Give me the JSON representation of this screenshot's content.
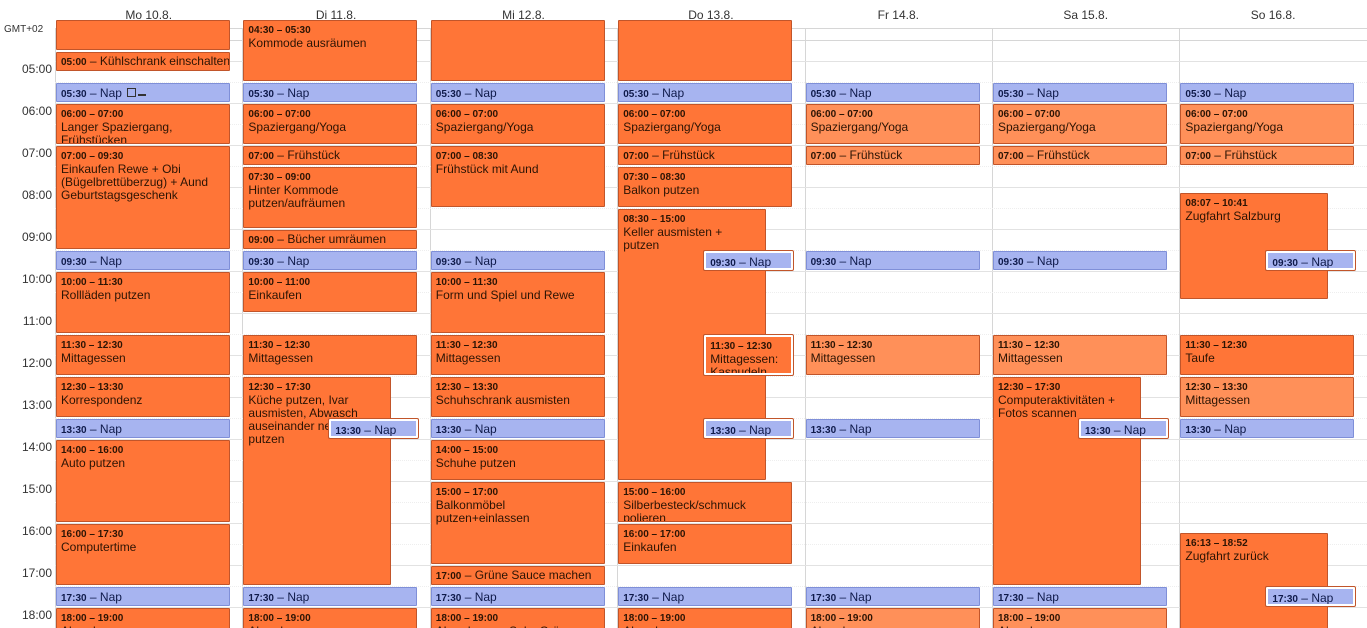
{
  "timezone": "GMT+02",
  "days": [
    "Mo 10.8.",
    "Di 11.8.",
    "Mi 12.8.",
    "Do 13.8.",
    "Fr 14.8.",
    "Sa 15.8.",
    "So 16.8."
  ],
  "hours": [
    "05:00",
    "06:00",
    "07:00",
    "08:00",
    "09:00",
    "10:00",
    "11:00",
    "12:00",
    "13:00",
    "14:00",
    "15:00",
    "16:00",
    "17:00",
    "18:00"
  ],
  "events": [
    {
      "day": 0,
      "start": "04:00",
      "end": "04:45",
      "time": "",
      "title": "",
      "color": "orange"
    },
    {
      "day": 0,
      "start": "04:45",
      "end": "05:15",
      "time": "05:00",
      "title": "Kühlschrank einschalten",
      "color": "orange",
      "oneline": true
    },
    {
      "day": 0,
      "start": "05:30",
      "end": "06:00",
      "time": "05:30",
      "title": "Nap",
      "color": "blue",
      "oneline": true,
      "icons": true
    },
    {
      "day": 0,
      "start": "06:00",
      "end": "07:00",
      "time": "06:00 – 07:00",
      "title": "Langer Spaziergang, Frühstücken",
      "color": "orange"
    },
    {
      "day": 0,
      "start": "07:00",
      "end": "09:30",
      "time": "07:00 – 09:30",
      "title": "Einkaufen Rewe + Obi (Bügelbrettüberzug) + Aund Geburtstagsgeschenk",
      "color": "orange"
    },
    {
      "day": 0,
      "start": "09:30",
      "end": "10:00",
      "time": "09:30",
      "title": "Nap",
      "color": "blue",
      "oneline": true
    },
    {
      "day": 0,
      "start": "10:00",
      "end": "11:30",
      "time": "10:00 – 11:30",
      "title": "Rollläden putzen",
      "color": "orange"
    },
    {
      "day": 0,
      "start": "11:30",
      "end": "12:30",
      "time": "11:30 – 12:30",
      "title": "Mittagessen",
      "color": "orange"
    },
    {
      "day": 0,
      "start": "12:30",
      "end": "13:30",
      "time": "12:30 – 13:30",
      "title": "Korrespondenz",
      "color": "orange"
    },
    {
      "day": 0,
      "start": "13:30",
      "end": "14:00",
      "time": "13:30",
      "title": "Nap",
      "color": "blue",
      "oneline": true
    },
    {
      "day": 0,
      "start": "14:00",
      "end": "16:00",
      "time": "14:00 – 16:00",
      "title": "Auto putzen",
      "color": "orange"
    },
    {
      "day": 0,
      "start": "16:00",
      "end": "17:30",
      "time": "16:00 – 17:30",
      "title": "Computertime",
      "color": "orange"
    },
    {
      "day": 0,
      "start": "17:30",
      "end": "18:00",
      "time": "17:30",
      "title": "Nap",
      "color": "blue",
      "oneline": true
    },
    {
      "day": 0,
      "start": "18:00",
      "end": "19:00",
      "time": "18:00 – 19:00",
      "title": "Abendessen",
      "color": "orange"
    },
    {
      "day": 1,
      "start": "04:00",
      "end": "05:30",
      "time": "04:30 – 05:30",
      "title": "Kommode ausräumen",
      "color": "orange"
    },
    {
      "day": 1,
      "start": "05:30",
      "end": "06:00",
      "time": "05:30",
      "title": "Nap",
      "color": "blue",
      "oneline": true
    },
    {
      "day": 1,
      "start": "06:00",
      "end": "07:00",
      "time": "06:00 – 07:00",
      "title": "Spaziergang/Yoga",
      "color": "orange"
    },
    {
      "day": 1,
      "start": "07:00",
      "end": "07:30",
      "time": "07:00",
      "title": "Frühstück",
      "color": "orange",
      "oneline": true
    },
    {
      "day": 1,
      "start": "07:30",
      "end": "09:00",
      "time": "07:30 – 09:00",
      "title": "Hinter Kommode putzen/aufräumen",
      "color": "orange"
    },
    {
      "day": 1,
      "start": "09:00",
      "end": "09:30",
      "time": "09:00",
      "title": "Bücher umräumen",
      "color": "orange",
      "oneline": true
    },
    {
      "day": 1,
      "start": "09:30",
      "end": "10:00",
      "time": "09:30",
      "title": "Nap",
      "color": "blue",
      "oneline": true
    },
    {
      "day": 1,
      "start": "10:00",
      "end": "11:00",
      "time": "10:00 – 11:00",
      "title": "Einkaufen",
      "color": "orange"
    },
    {
      "day": 1,
      "start": "11:30",
      "end": "12:30",
      "time": "11:30 – 12:30",
      "title": "Mittagessen",
      "color": "orange"
    },
    {
      "day": 1,
      "start": "12:30",
      "end": "17:30",
      "time": "12:30 – 17:30",
      "title": "Küche putzen, Ivar ausmisten, Abwasch auseinander nehmen, putzen",
      "color": "orange",
      "narrow": true
    },
    {
      "day": 1,
      "start": "13:30",
      "end": "14:00",
      "time": "13:30",
      "title": "Nap",
      "color": "blue",
      "oneline": true,
      "overlay": true
    },
    {
      "day": 1,
      "start": "17:30",
      "end": "18:00",
      "time": "17:30",
      "title": "Nap",
      "color": "blue",
      "oneline": true
    },
    {
      "day": 1,
      "start": "18:00",
      "end": "19:00",
      "time": "18:00 – 19:00",
      "title": "Abendessen",
      "color": "orange"
    },
    {
      "day": 2,
      "start": "04:00",
      "end": "05:30",
      "time": "",
      "title": "",
      "color": "orange"
    },
    {
      "day": 2,
      "start": "05:30",
      "end": "06:00",
      "time": "05:30",
      "title": "Nap",
      "color": "blue",
      "oneline": true
    },
    {
      "day": 2,
      "start": "06:00",
      "end": "07:00",
      "time": "06:00 – 07:00",
      "title": "Spaziergang/Yoga",
      "color": "orange"
    },
    {
      "day": 2,
      "start": "07:00",
      "end": "08:30",
      "time": "07:00 – 08:30",
      "title": "Frühstück mit Aund",
      "color": "orange"
    },
    {
      "day": 2,
      "start": "09:30",
      "end": "10:00",
      "time": "09:30",
      "title": "Nap",
      "color": "blue",
      "oneline": true
    },
    {
      "day": 2,
      "start": "10:00",
      "end": "11:30",
      "time": "10:00 – 11:30",
      "title": "Form und Spiel und Rewe",
      "color": "orange"
    },
    {
      "day": 2,
      "start": "11:30",
      "end": "12:30",
      "time": "11:30 – 12:30",
      "title": "Mittagessen",
      "color": "orange"
    },
    {
      "day": 2,
      "start": "12:30",
      "end": "13:30",
      "time": "12:30 – 13:30",
      "title": "Schuhschrank ausmisten",
      "color": "orange"
    },
    {
      "day": 2,
      "start": "13:30",
      "end": "14:00",
      "time": "13:30",
      "title": "Nap",
      "color": "blue",
      "oneline": true
    },
    {
      "day": 2,
      "start": "14:00",
      "end": "15:00",
      "time": "14:00 – 15:00",
      "title": "Schuhe putzen",
      "color": "orange"
    },
    {
      "day": 2,
      "start": "15:00",
      "end": "17:00",
      "time": "15:00 – 17:00",
      "title": "Balkonmöbel putzen+einlassen",
      "color": "orange"
    },
    {
      "day": 2,
      "start": "17:00",
      "end": "17:30",
      "time": "17:00",
      "title": "Grüne Sauce machen",
      "color": "orange",
      "oneline": true
    },
    {
      "day": 2,
      "start": "17:30",
      "end": "18:00",
      "time": "17:30",
      "title": "Nap",
      "color": "blue",
      "oneline": true
    },
    {
      "day": 2,
      "start": "18:00",
      "end": "19:00",
      "time": "18:00 – 19:00",
      "title": "Abendessen: Sulz+Grüne",
      "color": "orange"
    },
    {
      "day": 3,
      "start": "04:00",
      "end": "05:30",
      "time": "",
      "title": "",
      "color": "orange"
    },
    {
      "day": 3,
      "start": "05:30",
      "end": "06:00",
      "time": "05:30",
      "title": "Nap",
      "color": "blue",
      "oneline": true
    },
    {
      "day": 3,
      "start": "06:00",
      "end": "07:00",
      "time": "06:00 – 07:00",
      "title": "Spaziergang/Yoga",
      "color": "orange"
    },
    {
      "day": 3,
      "start": "07:00",
      "end": "07:30",
      "time": "07:00",
      "title": "Frühstück",
      "color": "orange",
      "oneline": true
    },
    {
      "day": 3,
      "start": "07:30",
      "end": "08:30",
      "time": "07:30 – 08:30",
      "title": "Balkon putzen",
      "color": "orange"
    },
    {
      "day": 3,
      "start": "08:30",
      "end": "15:00",
      "time": "08:30 – 15:00",
      "title": "Keller ausmisten + putzen",
      "color": "orange",
      "narrow": true
    },
    {
      "day": 3,
      "start": "09:30",
      "end": "10:00",
      "time": "09:30",
      "title": "Nap",
      "color": "blue",
      "oneline": true,
      "overlay": true
    },
    {
      "day": 3,
      "start": "11:30",
      "end": "12:30",
      "time": "11:30 – 12:30",
      "title": "Mittagessen: Kasnudeln",
      "color": "orange",
      "overlay": true
    },
    {
      "day": 3,
      "start": "13:30",
      "end": "14:00",
      "time": "13:30",
      "title": "Nap",
      "color": "blue",
      "oneline": true,
      "overlay": true
    },
    {
      "day": 3,
      "start": "15:00",
      "end": "16:00",
      "time": "15:00 – 16:00",
      "title": "Silberbesteck/schmuck polieren",
      "color": "orange"
    },
    {
      "day": 3,
      "start": "16:00",
      "end": "17:00",
      "time": "16:00 – 17:00",
      "title": "Einkaufen",
      "color": "orange"
    },
    {
      "day": 3,
      "start": "17:30",
      "end": "18:00",
      "time": "17:30",
      "title": "Nap",
      "color": "blue",
      "oneline": true
    },
    {
      "day": 3,
      "start": "18:00",
      "end": "19:00",
      "time": "18:00 – 19:00",
      "title": "Abendessen",
      "color": "orange"
    },
    {
      "day": 4,
      "start": "05:30",
      "end": "06:00",
      "time": "05:30",
      "title": "Nap",
      "color": "blue",
      "oneline": true
    },
    {
      "day": 4,
      "start": "06:00",
      "end": "07:00",
      "time": "06:00 – 07:00",
      "title": "Spaziergang/Yoga",
      "color": "light"
    },
    {
      "day": 4,
      "start": "07:00",
      "end": "07:30",
      "time": "07:00",
      "title": "Frühstück",
      "color": "light",
      "oneline": true
    },
    {
      "day": 4,
      "start": "09:30",
      "end": "10:00",
      "time": "09:30",
      "title": "Nap",
      "color": "blue",
      "oneline": true
    },
    {
      "day": 4,
      "start": "11:30",
      "end": "12:30",
      "time": "11:30 – 12:30",
      "title": "Mittagessen",
      "color": "light"
    },
    {
      "day": 4,
      "start": "13:30",
      "end": "14:00",
      "time": "13:30",
      "title": "Nap",
      "color": "blue",
      "oneline": true
    },
    {
      "day": 4,
      "start": "17:30",
      "end": "18:00",
      "time": "17:30",
      "title": "Nap",
      "color": "blue",
      "oneline": true
    },
    {
      "day": 4,
      "start": "18:00",
      "end": "19:00",
      "time": "18:00 – 19:00",
      "title": "Abendessen",
      "color": "light"
    },
    {
      "day": 5,
      "start": "05:30",
      "end": "06:00",
      "time": "05:30",
      "title": "Nap",
      "color": "blue",
      "oneline": true
    },
    {
      "day": 5,
      "start": "06:00",
      "end": "07:00",
      "time": "06:00 – 07:00",
      "title": "Spaziergang/Yoga",
      "color": "light"
    },
    {
      "day": 5,
      "start": "07:00",
      "end": "07:30",
      "time": "07:00",
      "title": "Frühstück",
      "color": "light",
      "oneline": true
    },
    {
      "day": 5,
      "start": "09:30",
      "end": "10:00",
      "time": "09:30",
      "title": "Nap",
      "color": "blue",
      "oneline": true
    },
    {
      "day": 5,
      "start": "11:30",
      "end": "12:30",
      "time": "11:30 – 12:30",
      "title": "Mittagessen",
      "color": "light"
    },
    {
      "day": 5,
      "start": "12:30",
      "end": "17:30",
      "time": "12:30 – 17:30",
      "title": "Computeraktivitäten + Fotos scannen",
      "color": "orange",
      "narrow": true
    },
    {
      "day": 5,
      "start": "13:30",
      "end": "14:00",
      "time": "13:30",
      "title": "Nap",
      "color": "blue",
      "oneline": true,
      "overlay": true
    },
    {
      "day": 5,
      "start": "17:30",
      "end": "18:00",
      "time": "17:30",
      "title": "Nap",
      "color": "blue",
      "oneline": true
    },
    {
      "day": 5,
      "start": "18:00",
      "end": "19:00",
      "time": "18:00 – 19:00",
      "title": "Abendessen",
      "color": "light"
    },
    {
      "day": 6,
      "start": "05:30",
      "end": "06:00",
      "time": "05:30",
      "title": "Nap",
      "color": "blue",
      "oneline": true
    },
    {
      "day": 6,
      "start": "06:00",
      "end": "07:00",
      "time": "06:00 – 07:00",
      "title": "Spaziergang/Yoga",
      "color": "light"
    },
    {
      "day": 6,
      "start": "07:00",
      "end": "07:30",
      "time": "07:00",
      "title": "Frühstück",
      "color": "light",
      "oneline": true
    },
    {
      "day": 6,
      "start": "08:07",
      "end": "10:41",
      "time": "08:07 – 10:41",
      "title": "Zugfahrt Salzburg",
      "color": "orange",
      "narrow": true
    },
    {
      "day": 6,
      "start": "09:30",
      "end": "10:00",
      "time": "09:30",
      "title": "Nap",
      "color": "blue",
      "oneline": true,
      "overlay": true
    },
    {
      "day": 6,
      "start": "11:30",
      "end": "12:30",
      "time": "11:30 – 12:30",
      "title": "Taufe",
      "color": "orange"
    },
    {
      "day": 6,
      "start": "12:30",
      "end": "13:30",
      "time": "12:30 – 13:30",
      "title": "Mittagessen",
      "color": "light"
    },
    {
      "day": 6,
      "start": "13:30",
      "end": "14:00",
      "time": "13:30",
      "title": "Nap",
      "color": "blue",
      "oneline": true
    },
    {
      "day": 6,
      "start": "16:13",
      "end": "18:52",
      "time": "16:13 – 18:52",
      "title": "Zugfahrt zurück",
      "color": "orange",
      "narrow": true
    },
    {
      "day": 6,
      "start": "17:30",
      "end": "18:00",
      "time": "17:30",
      "title": "Nap",
      "color": "blue",
      "oneline": true,
      "overlay": true
    }
  ]
}
